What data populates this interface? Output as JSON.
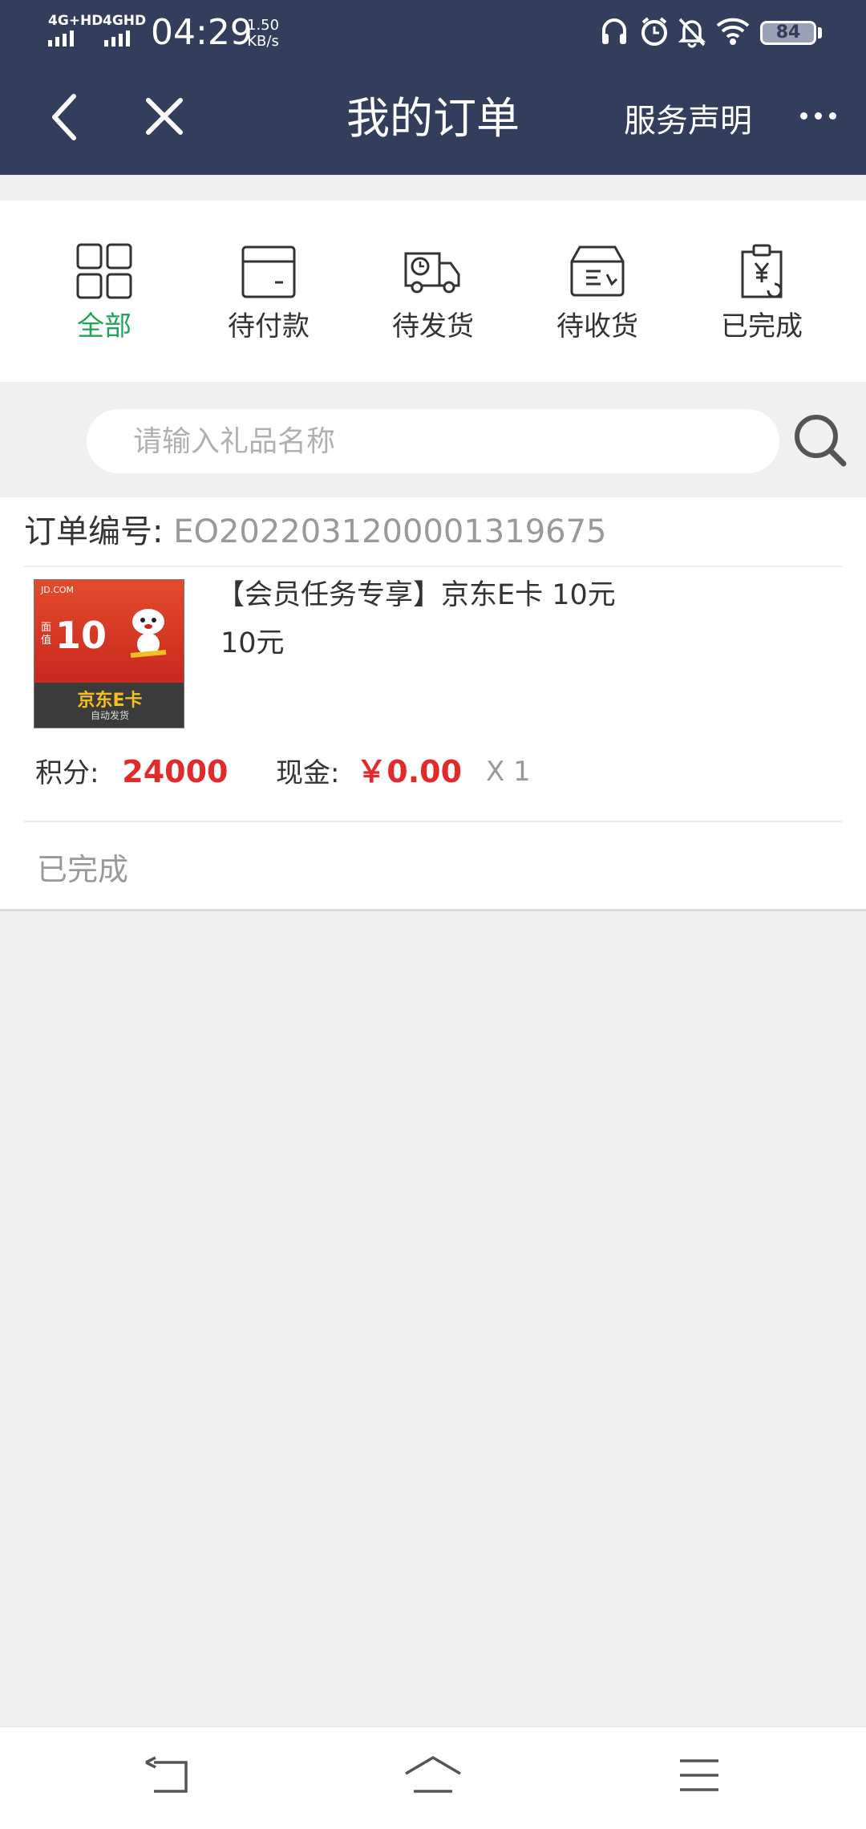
{
  "status_bar": {
    "network_1": "4G+HD",
    "network_2": "4GHD",
    "time": "04:29",
    "speed_value": "1.50",
    "speed_unit": "KB/s",
    "battery": "84",
    "icons": [
      "headphones-icon",
      "alarm-icon",
      "mute-bell-icon",
      "wifi-icon",
      "battery-icon"
    ]
  },
  "nav": {
    "title": "我的订单",
    "service_label": "服务声明",
    "icons": [
      "back-icon",
      "close-icon",
      "more-icon"
    ]
  },
  "tabs": [
    {
      "label": "全部",
      "icon": "grid-icon",
      "active": true
    },
    {
      "label": "待付款",
      "icon": "wallet-icon",
      "active": false
    },
    {
      "label": "待发货",
      "icon": "delivery-truck-icon",
      "active": false
    },
    {
      "label": "待收货",
      "icon": "package-box-icon",
      "active": false
    },
    {
      "label": "已完成",
      "icon": "clipboard-yen-icon",
      "active": false
    }
  ],
  "colors": {
    "header_bg": "#333d5c",
    "active_tab": "#22a35a",
    "price_red": "#e32a2a"
  },
  "search": {
    "placeholder": "请输入礼品名称",
    "value": ""
  },
  "order": {
    "number_label": "订单编号:",
    "number_value": "EO20220312000013196​75",
    "product_title": "【会员任务专享】京东E卡 10元",
    "product_price": "10元",
    "image_text": {
      "denomination": "10",
      "side_text": "面值",
      "brand": "京东E卡",
      "subtitle": "自动发货"
    },
    "points_label": "积分:",
    "points_value": "24000",
    "cash_label": "现金:",
    "cash_value": "￥0.00",
    "quantity": "X 1",
    "status": "已完成"
  },
  "bottom_nav": {
    "icons": [
      "back-nav-icon",
      "home-nav-icon",
      "menu-nav-icon"
    ]
  }
}
